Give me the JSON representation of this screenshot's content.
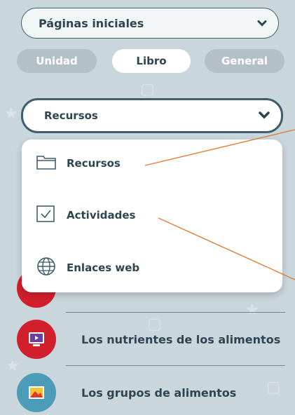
{
  "header_select": {
    "value": "Páginas iniciales"
  },
  "tabs": [
    {
      "label": "Unidad",
      "active": false
    },
    {
      "label": "Libro",
      "active": true
    },
    {
      "label": "General",
      "active": false
    }
  ],
  "type_select": {
    "value": "Recursos"
  },
  "menu": {
    "items": [
      {
        "label": "Recursos",
        "icon": "folder-icon"
      },
      {
        "label": "Actividades",
        "icon": "checkbox-icon"
      },
      {
        "label": "Enlaces web",
        "icon": "globe-icon"
      }
    ]
  },
  "list": {
    "items": [
      {
        "label": "Los nutrientes de los alimentos",
        "icon": "video-icon",
        "color": "#d21f2c"
      },
      {
        "label": "Los grupos de alimentos",
        "icon": "image-icon",
        "color": "#4a9cb8"
      }
    ]
  },
  "colors": {
    "background": "#c9d6dc",
    "tab_inactive": "#b3c1c7",
    "accent_line": "#e07a2f",
    "text_dark": "#2e4450"
  }
}
